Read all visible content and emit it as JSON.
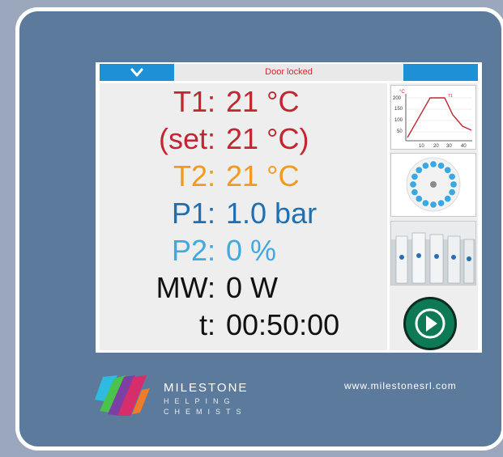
{
  "topbar": {
    "status": "Door locked"
  },
  "readings": [
    {
      "label": "T1:",
      "value": "21 °C",
      "color": "#c42630"
    },
    {
      "label": "(set:",
      "value": "21 °C)",
      "color": "#c42630"
    },
    {
      "label": "T2:",
      "value": "21 °C",
      "color": "#f29a1f"
    },
    {
      "label": "P1:",
      "value": "1.0 bar",
      "color": "#1f6fb3"
    },
    {
      "label": "P2:",
      "value": "0 %",
      "color": "#40a9e0"
    },
    {
      "label": "MW:",
      "value": "0 W",
      "color": "#111111"
    },
    {
      "label": "t:",
      "value": "00:50:00",
      "color": "#111111"
    }
  ],
  "mini_chart": {
    "unit": "°C",
    "y_ticks": [
      "200",
      "150",
      "100",
      "50"
    ],
    "x_ticks": [
      "10",
      "20",
      "30",
      "40"
    ],
    "series_label": "T1"
  },
  "footer": {
    "brand": "MILESTONE",
    "tag_line1": "HELPING",
    "tag_line2": "CHEMISTS",
    "url": "www.milestonesrl.com"
  },
  "icons": {
    "menu": "chevron-down-icon",
    "start": "play-icon",
    "rotor": "rotor-icon",
    "vessels": "vessels-photo"
  },
  "colors": {
    "accent": "#1e90d5",
    "status_text": "#d7262e",
    "start_button": "#0d7a55",
    "panel": "#5c7a9b"
  }
}
